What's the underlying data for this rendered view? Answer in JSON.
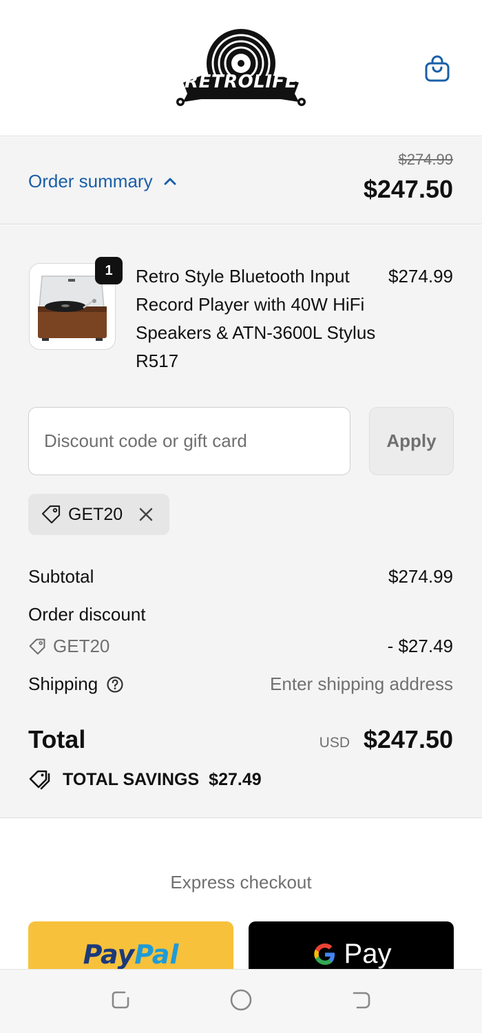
{
  "header": {
    "logo_text": "RETROLIFE"
  },
  "summary_bar": {
    "toggle_label": "Order summary",
    "original_price": "$274.99",
    "discounted_price": "$247.50"
  },
  "product": {
    "quantity": "1",
    "name": "Retro Style Bluetooth Input Record Player with 40W HiFi Speakers & ATN-3600L Stylus R517",
    "price": "$274.99"
  },
  "discount": {
    "placeholder": "Discount code or gift card",
    "apply_label": "Apply",
    "applied_code": "GET20"
  },
  "costs": {
    "subtotal_label": "Subtotal",
    "subtotal_value": "$274.99",
    "order_discount_label": "Order discount",
    "discount_code": "GET20",
    "discount_value": "- $27.49",
    "shipping_label": "Shipping",
    "shipping_value": "Enter shipping address"
  },
  "total": {
    "label": "Total",
    "currency": "USD",
    "value": "$247.50",
    "savings_label": "TOTAL SAVINGS",
    "savings_value": "$27.49"
  },
  "express": {
    "label": "Express checkout",
    "paypal_part1": "Pay",
    "paypal_part2": "Pal",
    "gpay_label": "Pay"
  },
  "colors": {
    "link_blue": "#1a5fa8",
    "paypal_yellow": "#f7c13b",
    "summary_bg": "#f4f4f4"
  }
}
